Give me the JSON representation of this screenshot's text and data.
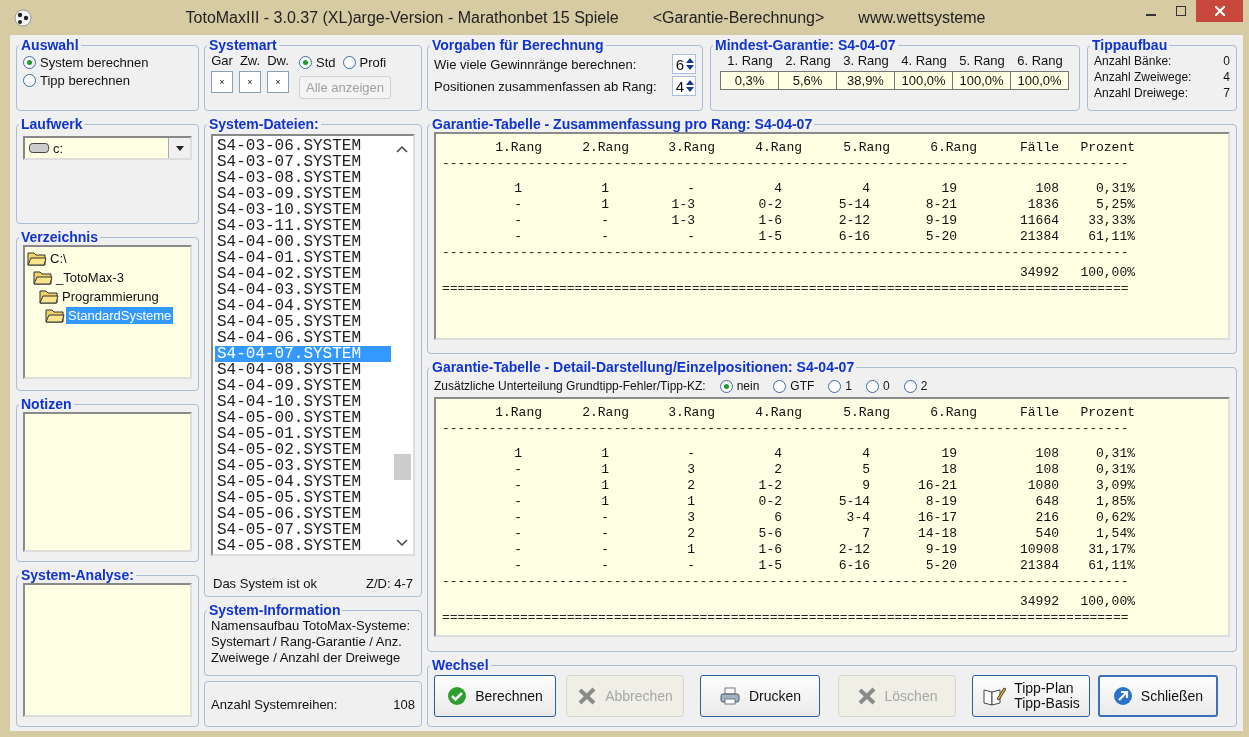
{
  "window": {
    "title": "TotoMaxIII - 3.0.37 (XL)arge-Version - Marathonbet 15 Spiele",
    "subtitle": "<Garantie-Berechnung>",
    "website": "www.wettsysteme"
  },
  "auswahl": {
    "title": "Auswahl",
    "options": [
      {
        "label": "System berechnen",
        "selected": true
      },
      {
        "label": "Tipp berechnen",
        "selected": false
      }
    ]
  },
  "systemart": {
    "title": "Systemart",
    "fields": [
      {
        "label": "Gar",
        "value": "×"
      },
      {
        "label": "Zw.",
        "value": "×"
      },
      {
        "label": "Dw.",
        "value": "×"
      }
    ],
    "modes": [
      {
        "label": "Std",
        "selected": true
      },
      {
        "label": "Profi",
        "selected": false
      }
    ],
    "show_all": {
      "label": "Alle anzeigen",
      "disabled": true
    }
  },
  "vorgaben": {
    "title": "Vorgaben für Berechnung",
    "rows": [
      {
        "label": "Wie viele Gewinnränge berechnen:",
        "value": "6"
      },
      {
        "label": "Positionen zusammenfassen ab Rang:",
        "value": "4"
      }
    ]
  },
  "mindest_garantie": {
    "title": "Mindest-Garantie: S4-04-07",
    "columns": [
      "1. Rang",
      "2. Rang",
      "3. Rang",
      "4. Rang",
      "5. Rang",
      "6. Rang"
    ],
    "values": [
      "0,3%",
      "5,6%",
      "38,9%",
      "100,0%",
      "100,0%",
      "100,0%"
    ]
  },
  "tippaufbau": {
    "title": "Tippaufbau",
    "rows": [
      {
        "label": "Anzahl Bänke:",
        "value": "0"
      },
      {
        "label": "Anzahl Zweiwege:",
        "value": "4"
      },
      {
        "label": "Anzahl Dreiwege:",
        "value": "7"
      }
    ]
  },
  "laufwerk": {
    "title": "Laufwerk",
    "value": "c:"
  },
  "verzeichnis": {
    "title": "Verzeichnis",
    "tree": [
      {
        "label": "C:\\",
        "selected": false,
        "children": [
          {
            "label": "_TotoMax-3",
            "selected": false,
            "children": [
              {
                "label": "Programmierung",
                "selected": false,
                "children": [
                  {
                    "label": "StandardSysteme",
                    "selected": true
                  }
                ]
              }
            ]
          }
        ]
      }
    ]
  },
  "notizen": {
    "title": "Notizen"
  },
  "system_analyse": {
    "title": "System-Analyse:"
  },
  "system_dateien": {
    "title": "System-Dateien:",
    "files": [
      {
        "name": "S4-03-06.SYSTEM",
        "selected": false
      },
      {
        "name": "S4-03-07.SYSTEM",
        "selected": false
      },
      {
        "name": "S4-03-08.SYSTEM",
        "selected": false
      },
      {
        "name": "S4-03-09.SYSTEM",
        "selected": false
      },
      {
        "name": "S4-03-10.SYSTEM",
        "selected": false
      },
      {
        "name": "S4-03-11.SYSTEM",
        "selected": false
      },
      {
        "name": "S4-04-00.SYSTEM",
        "selected": false
      },
      {
        "name": "S4-04-01.SYSTEM",
        "selected": false
      },
      {
        "name": "S4-04-02.SYSTEM",
        "selected": false
      },
      {
        "name": "S4-04-03.SYSTEM",
        "selected": false
      },
      {
        "name": "S4-04-04.SYSTEM",
        "selected": false
      },
      {
        "name": "S4-04-05.SYSTEM",
        "selected": false
      },
      {
        "name": "S4-04-06.SYSTEM",
        "selected": false
      },
      {
        "name": "S4-04-07.SYSTEM",
        "selected": true
      },
      {
        "name": "S4-04-08.SYSTEM",
        "selected": false
      },
      {
        "name": "S4-04-09.SYSTEM",
        "selected": false
      },
      {
        "name": "S4-04-10.SYSTEM",
        "selected": false
      },
      {
        "name": "S4-05-00.SYSTEM",
        "selected": false
      },
      {
        "name": "S4-05-01.SYSTEM",
        "selected": false
      },
      {
        "name": "S4-05-02.SYSTEM",
        "selected": false
      },
      {
        "name": "S4-05-03.SYSTEM",
        "selected": false
      },
      {
        "name": "S4-05-04.SYSTEM",
        "selected": false
      },
      {
        "name": "S4-05-05.SYSTEM",
        "selected": false
      },
      {
        "name": "S4-05-06.SYSTEM",
        "selected": false
      },
      {
        "name": "S4-05-07.SYSTEM",
        "selected": false
      },
      {
        "name": "S4-05-08.SYSTEM",
        "selected": false
      }
    ],
    "status": "Das System ist ok",
    "zd": "Z/D: 4-7"
  },
  "system_information": {
    "title": "System-Information",
    "text": "Namensaufbau TotoMax-Systeme: Systemart / Rang-Garantie / Anz. Zweiwege / Anzahl der Dreiwege",
    "count_label": "Anzahl Systemreihen:",
    "count": "108"
  },
  "garantie_tabelle": {
    "title": "Garantie-Tabelle - Zusammenfassung pro Rang: S4-04-07",
    "lines": [
      {
        "kind": "header",
        "cells": [
          "1.Rang",
          "2.Rang",
          "3.Rang",
          "4.Rang",
          "5.Rang",
          "6.Rang",
          "Fälle",
          "Prozent"
        ]
      },
      {
        "kind": "rule",
        "text": "----------------------------------------------------------------------------------------"
      },
      {
        "kind": "row",
        "cells": [
          "1",
          "1",
          "-",
          "4",
          "4",
          "19",
          "108",
          "0,31%"
        ]
      },
      {
        "kind": "row",
        "cells": [
          "-",
          "1",
          "1-3",
          "0-2",
          "5-14",
          "8-21",
          "1836",
          "5,25%"
        ]
      },
      {
        "kind": "row",
        "cells": [
          "-",
          "-",
          "1-3",
          "1-6",
          "2-12",
          "9-19",
          "11664",
          "33,33%"
        ]
      },
      {
        "kind": "row",
        "cells": [
          "-",
          "-",
          "-",
          "1-5",
          "6-16",
          "5-20",
          "21384",
          "61,11%"
        ]
      },
      {
        "kind": "rule",
        "text": "----------------------------------------------------------------------------------------"
      },
      {
        "kind": "total",
        "cells": [
          "34992",
          "100,00%"
        ]
      },
      {
        "kind": "rule",
        "text": "========================================================================================"
      }
    ]
  },
  "detail": {
    "title": "Garantie-Tabelle - Detail-Darstellung/Einzelpositionen: S4-04-07",
    "filter_label": "Zusätzliche Unterteilung Grundtipp-Fehler/Tipp-KZ:",
    "filter_options": [
      {
        "label": "nein",
        "selected": true
      },
      {
        "label": "GTF",
        "selected": false
      },
      {
        "label": "1",
        "selected": false
      },
      {
        "label": "0",
        "selected": false
      },
      {
        "label": "2",
        "selected": false
      }
    ],
    "lines": [
      {
        "kind": "header",
        "cells": [
          "1.Rang",
          "2.Rang",
          "3.Rang",
          "4.Rang",
          "5.Rang",
          "6.Rang",
          "Fälle",
          "Prozent"
        ]
      },
      {
        "kind": "rule",
        "text": "----------------------------------------------------------------------------------------"
      },
      {
        "kind": "row",
        "cells": [
          "1",
          "1",
          "-",
          "4",
          "4",
          "19",
          "108",
          "0,31%"
        ]
      },
      {
        "kind": "row",
        "cells": [
          "-",
          "1",
          "3",
          "2",
          "5",
          "18",
          "108",
          "0,31%"
        ]
      },
      {
        "kind": "row",
        "cells": [
          "-",
          "1",
          "2",
          "1-2",
          "9",
          "16-21",
          "1080",
          "3,09%"
        ]
      },
      {
        "kind": "row",
        "cells": [
          "-",
          "1",
          "1",
          "0-2",
          "5-14",
          "8-19",
          "648",
          "1,85%"
        ]
      },
      {
        "kind": "row",
        "cells": [
          "-",
          "-",
          "3",
          "6",
          "3-4",
          "16-17",
          "216",
          "0,62%"
        ]
      },
      {
        "kind": "row",
        "cells": [
          "-",
          "-",
          "2",
          "5-6",
          "7",
          "14-18",
          "540",
          "1,54%"
        ]
      },
      {
        "kind": "row",
        "cells": [
          "-",
          "-",
          "1",
          "1-6",
          "2-12",
          "9-19",
          "10908",
          "31,17%"
        ]
      },
      {
        "kind": "row",
        "cells": [
          "-",
          "-",
          "-",
          "1-5",
          "6-16",
          "5-20",
          "21384",
          "61,11%"
        ]
      },
      {
        "kind": "rule",
        "text": "----------------------------------------------------------------------------------------"
      },
      {
        "kind": "total",
        "cells": [
          "34992",
          "100,00%"
        ]
      },
      {
        "kind": "rule",
        "text": "========================================================================================"
      }
    ]
  },
  "wechsel": {
    "title": "Wechsel",
    "buttons": [
      {
        "label": "Berechnen",
        "kind": "check",
        "disabled": false,
        "default": false
      },
      {
        "label": "Abbrechen",
        "kind": "cross",
        "disabled": true,
        "default": false
      },
      {
        "label": "Drucken",
        "kind": "printer",
        "disabled": false,
        "default": false
      },
      {
        "label": "Löschen",
        "kind": "cross",
        "disabled": true,
        "default": false
      },
      {
        "label": "Tipp-Plan",
        "second_line": "Tipp-Basis",
        "kind": "book",
        "disabled": false,
        "default": false
      },
      {
        "label": "Schließen",
        "kind": "arrow",
        "disabled": false,
        "default": true
      }
    ]
  }
}
